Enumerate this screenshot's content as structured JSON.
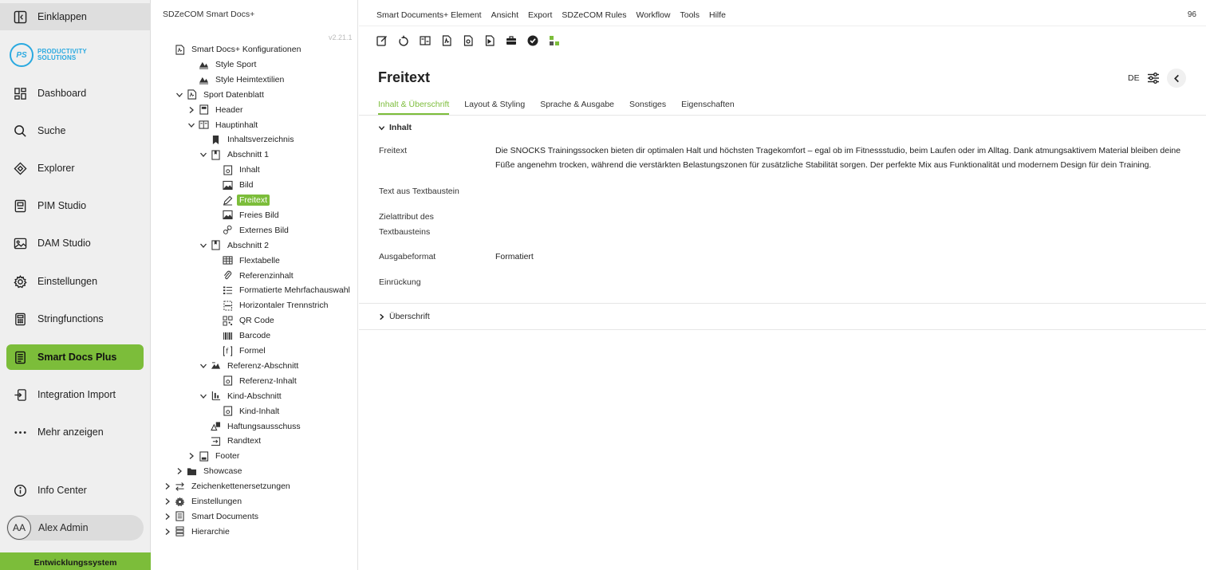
{
  "nav": {
    "collapse_label": "Einklappen",
    "logo": {
      "mark": "PS",
      "line1": "PRODUCTIVITY",
      "line2": "SOLUTIONS"
    },
    "items": [
      {
        "label": "Dashboard",
        "icon": "dashboard-icon"
      },
      {
        "label": "Suche",
        "icon": "search-icon"
      },
      {
        "label": "Explorer",
        "icon": "explorer-icon"
      },
      {
        "label": "PIM Studio",
        "icon": "pim-studio-icon"
      },
      {
        "label": "DAM Studio",
        "icon": "image-icon"
      },
      {
        "label": "Einstellungen",
        "icon": "gear-icon"
      },
      {
        "label": "Stringfunctions",
        "icon": "calculator-icon"
      },
      {
        "label": "Smart Docs Plus",
        "icon": "document-icon"
      },
      {
        "label": "Integration Import",
        "icon": "import-icon"
      },
      {
        "label": "Mehr anzeigen",
        "icon": "more-icon"
      }
    ],
    "info_center": "Info Center",
    "user": {
      "initials": "AA",
      "name": "Alex Admin"
    },
    "environment": "Entwicklungssystem",
    "accent_color": "#7cbd3a"
  },
  "tree": {
    "header": "SDZeCOM Smart Docs+",
    "version": "v2.21.1",
    "nodes": [
      {
        "label": "Smart Docs+ Konfigurationen",
        "icon": "pdf-icon",
        "expanded": true
      },
      {
        "label": "Style Sport",
        "icon": "style-icon"
      },
      {
        "label": "Style Heimtextilien",
        "icon": "style-icon"
      },
      {
        "label": "Sport Datenblatt",
        "icon": "pdf-icon",
        "expanded": true
      },
      {
        "label": "Header",
        "icon": "header-icon",
        "expanded": false
      },
      {
        "label": "Hauptinhalt",
        "icon": "content-icon",
        "expanded": true
      },
      {
        "label": "Inhaltsverzeichnis",
        "icon": "bookmark-icon"
      },
      {
        "label": "Abschnitt 1",
        "icon": "section-icon",
        "expanded": true
      },
      {
        "label": "Inhalt",
        "icon": "element-icon"
      },
      {
        "label": "Bild",
        "icon": "picture-icon"
      },
      {
        "label": "Freitext",
        "icon": "pen-icon",
        "selected": true
      },
      {
        "label": "Freies Bild",
        "icon": "picture-icon"
      },
      {
        "label": "Externes Bild",
        "icon": "link-icon"
      },
      {
        "label": "Abschnitt 2",
        "icon": "section-icon",
        "expanded": true
      },
      {
        "label": "Flextabelle",
        "icon": "table-icon"
      },
      {
        "label": "Referenzinhalt",
        "icon": "paperclip-icon"
      },
      {
        "label": "Formatierte Mehrfachauswahl",
        "icon": "list-icon"
      },
      {
        "label": "Horizontaler Trennstrich",
        "icon": "divider-icon"
      },
      {
        "label": "QR Code",
        "icon": "qr-code-icon"
      },
      {
        "label": "Barcode",
        "icon": "barcode-icon"
      },
      {
        "label": "Formel",
        "icon": "formula-icon"
      },
      {
        "label": "Referenz-Abschnitt",
        "icon": "reference-section-icon",
        "expanded": true
      },
      {
        "label": "Referenz-Inhalt",
        "icon": "element-icon"
      },
      {
        "label": "Kind-Abschnitt",
        "icon": "child-section-icon",
        "expanded": true
      },
      {
        "label": "Kind-Inhalt",
        "icon": "element-icon"
      },
      {
        "label": "Haftungsausschuss",
        "icon": "disclaimer-icon"
      },
      {
        "label": "Randtext",
        "icon": "margin-text-icon"
      },
      {
        "label": "Footer",
        "icon": "footer-icon",
        "expanded": false
      },
      {
        "label": "Showcase",
        "icon": "folder-icon",
        "expanded": false
      },
      {
        "label": "Zeichenkettenersetzungen",
        "icon": "swap-icon",
        "expanded": false
      },
      {
        "label": "Einstellungen",
        "icon": "gear-icon",
        "expanded": false
      },
      {
        "label": "Smart Documents",
        "icon": "smart-documents-icon",
        "expanded": false
      },
      {
        "label": "Hierarchie",
        "icon": "hierarchy-icon",
        "expanded": false
      }
    ]
  },
  "main": {
    "menu": [
      "Smart Documents+ Element",
      "Ansicht",
      "Export",
      "SDZeCOM Rules",
      "Workflow",
      "Tools",
      "Hilfe"
    ],
    "zoom": "96",
    "toolbar_icons": [
      "edit-icon",
      "refresh-icon",
      "compare-icon",
      "pdf-export-icon",
      "preview-icon",
      "document-export-icon",
      "briefcase-icon",
      "check-circle-icon",
      "dependency-icon"
    ],
    "title": "Freitext",
    "language": "DE",
    "tabs": [
      "Inhalt & Überschrift",
      "Layout & Styling",
      "Sprache & Ausgabe",
      "Sonstiges",
      "Eigenschaften"
    ],
    "active_tab": 0,
    "section_content": "Inhalt",
    "fields": {
      "freitext_label": "Freitext",
      "freitext_value": "Die SNOCKS Trainingssocken bieten dir optimalen Halt und höchsten Tragekomfort – egal ob im Fitnessstudio, beim Laufen oder im Alltag. Dank atmungsaktivem Material bleiben deine Füße angenehm trocken, während die verstärkten Belastungszonen für zusätzliche Stabilität sorgen. Der perfekte Mix aus Funktionalität und modernem Design für dein Training.",
      "text_aus_textbaustein_label": "Text aus Textbaustein",
      "zielattribut_label": "Zielattribut des Textbausteins",
      "ausgabeformat_label": "Ausgabeformat",
      "ausgabeformat_value": "Formatiert",
      "einrueckung_label": "Einrückung"
    },
    "section_heading": "Überschrift"
  }
}
